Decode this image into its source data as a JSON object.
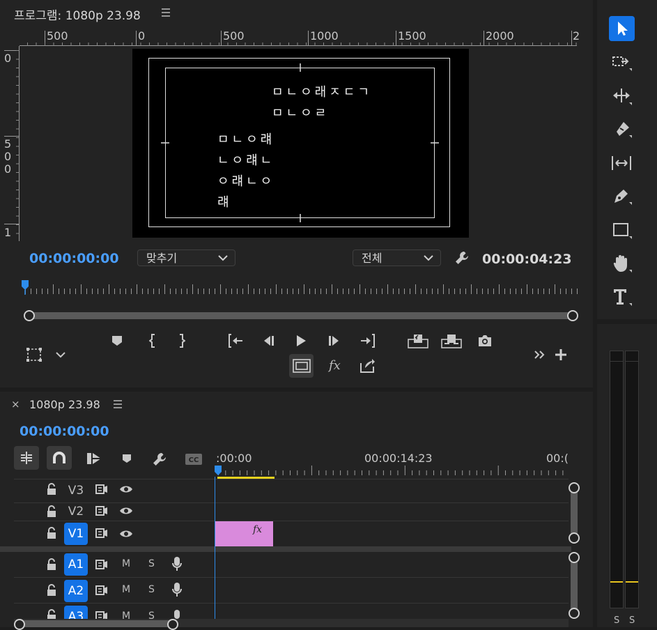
{
  "program_monitor": {
    "title": "프로그램: 1080p 23.98",
    "ruler_h_labels": [
      "500",
      "0",
      "500",
      "1000",
      "1500",
      "2000",
      "2"
    ],
    "ruler_v_labels": [
      "0",
      "5",
      "0",
      "0",
      "1"
    ],
    "frame_text": {
      "line1": "ㅁㄴㅇ래ㅈㄷㄱ",
      "line2": "ㅁㄴㅇㄹ",
      "line3": "ㅁㄴㅇ럐",
      "line4": "ㄴㅇ럐ㄴ",
      "line5": "ㅇ럐ㄴㅇ",
      "line6": "럐"
    },
    "timecode_current": "00:00:00:00",
    "fit_dropdown": "맞추기",
    "quality_dropdown": "전체",
    "timecode_duration": "00:00:04:23"
  },
  "timeline": {
    "close_label": "×",
    "sequence_tab": "1080p 23.98",
    "timecode": "00:00:00:00",
    "ruler_labels": [
      ":00:00",
      "00:00:14:23",
      "00:("
    ],
    "tracks": {
      "v3": "V3",
      "v2": "V2",
      "v1": "V1",
      "a1": "A1",
      "a2": "A2",
      "a3": "A3",
      "mute": "M",
      "solo": "S"
    },
    "clip_fx": "fx",
    "clip_color": "#d98adc"
  },
  "transport": {
    "fx_label": "fx"
  },
  "audio_meter": {
    "solo_left": "S",
    "solo_right": "S"
  },
  "colors": {
    "accent": "#4a9eff",
    "track_tag": "#1473e6",
    "playhead": "#2d8ceb",
    "work_area": "#e6d21e"
  }
}
